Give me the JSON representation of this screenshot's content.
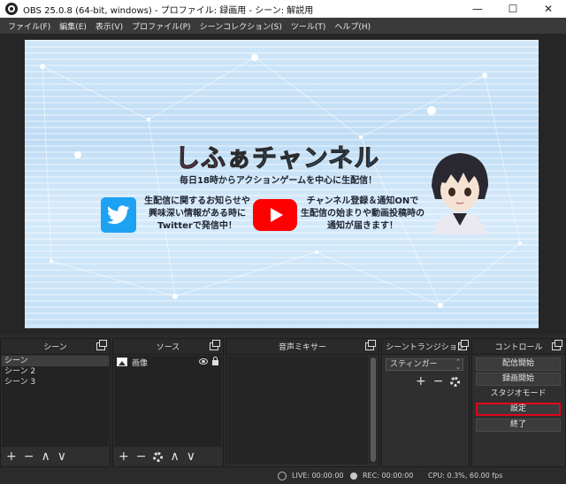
{
  "window": {
    "title": "OBS 25.0.8 (64-bit, windows) - プロファイル: 録画用 - シーン: 解説用",
    "minimize": "—",
    "maximize": "☐",
    "close": "✕"
  },
  "menu": [
    "ファイル(F)",
    "編集(E)",
    "表示(V)",
    "プロファイル(P)",
    "シーンコレクション(S)",
    "ツール(T)",
    "ヘルプ(H)"
  ],
  "preview": {
    "channel_title_pink": "しふぁ",
    "channel_title_blue": "チャンネル",
    "subtitle": "毎日18時からアクションゲームを中心に生配信！",
    "twitter_text": [
      "生配信に関するお知らせや",
      "興味深い情報がある時に",
      "Twitterで発信中！"
    ],
    "youtube_text": [
      "チャンネル登録＆通知ONで",
      "生配信の始まりや動画投稿時の",
      "通知が届きます！"
    ]
  },
  "docks": {
    "scenes": {
      "title": "シーン",
      "items": [
        "シーン",
        "シーン 2",
        "シーン 3"
      ]
    },
    "sources": {
      "title": "ソース",
      "items": [
        "画像"
      ]
    },
    "mixer": {
      "title": "音声ミキサー"
    },
    "transitions": {
      "title": "シーントランジション",
      "selected": "スティンガー"
    },
    "controls": {
      "title": "コントロール",
      "buttons": [
        "配信開始",
        "録画開始",
        "スタジオモード",
        "設定",
        "終了"
      ]
    }
  },
  "footer_glyphs": {
    "plus": "+",
    "minus": "−",
    "up": "∧",
    "down": "∨"
  },
  "status": {
    "live": "LIVE: 00:00:00",
    "rec": "REC: 00:00:00",
    "cpu": "CPU: 0.3%, 60.00 fps"
  },
  "icons": [
    "obs-app-icon",
    "twitter-icon",
    "youtube-icon",
    "image-source-icon",
    "eye-icon",
    "lock-icon",
    "gear-icon",
    "float-dock-icon"
  ],
  "colors": {
    "highlight_border": "#e3001b",
    "twitter_blue": "#1da1f2",
    "youtube_red": "#ff0000"
  }
}
